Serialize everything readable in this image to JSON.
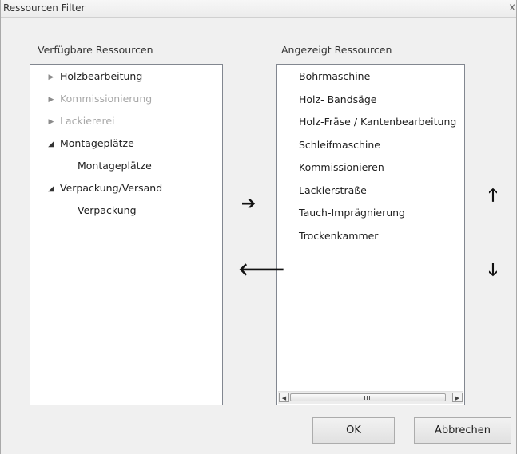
{
  "window": {
    "title": "Ressourcen Filter",
    "close_glyph": "x"
  },
  "available": {
    "label": "Verfügbare Ressourcen",
    "nodes": [
      {
        "label": "Holzbearbeitung",
        "state": "collapsed",
        "disabled": false
      },
      {
        "label": "Kommissionierung",
        "state": "collapsed",
        "disabled": true
      },
      {
        "label": "Lackiererei",
        "state": "collapsed",
        "disabled": true
      },
      {
        "label": "Montageplätze",
        "state": "expanded",
        "disabled": false
      },
      {
        "label": "Montageplätze",
        "state": "child",
        "disabled": false
      },
      {
        "label": "Verpackung/Versand",
        "state": "expanded",
        "disabled": false
      },
      {
        "label": "Verpackung",
        "state": "child",
        "disabled": false
      }
    ]
  },
  "displayed": {
    "label": "Angezeigt Ressourcen",
    "items": [
      "Bohrmaschine",
      "Holz- Bandsäge",
      "Holz-Fräse  / Kantenbearbeitung",
      "Schleifmaschine",
      "Kommissionieren",
      "Lackierstraße",
      "Tauch-Imprägnierung",
      "Trockenkammer"
    ]
  },
  "controls": {
    "add_glyph": "➔",
    "remove_glyph": "🡐",
    "up_glyph": "🡑",
    "down_glyph": "🡓"
  },
  "buttons": {
    "ok": "OK",
    "cancel": "Abbrechen"
  },
  "icons": {
    "collapsed": "tree-collapsed-icon",
    "expanded": "tree-expanded-icon"
  }
}
